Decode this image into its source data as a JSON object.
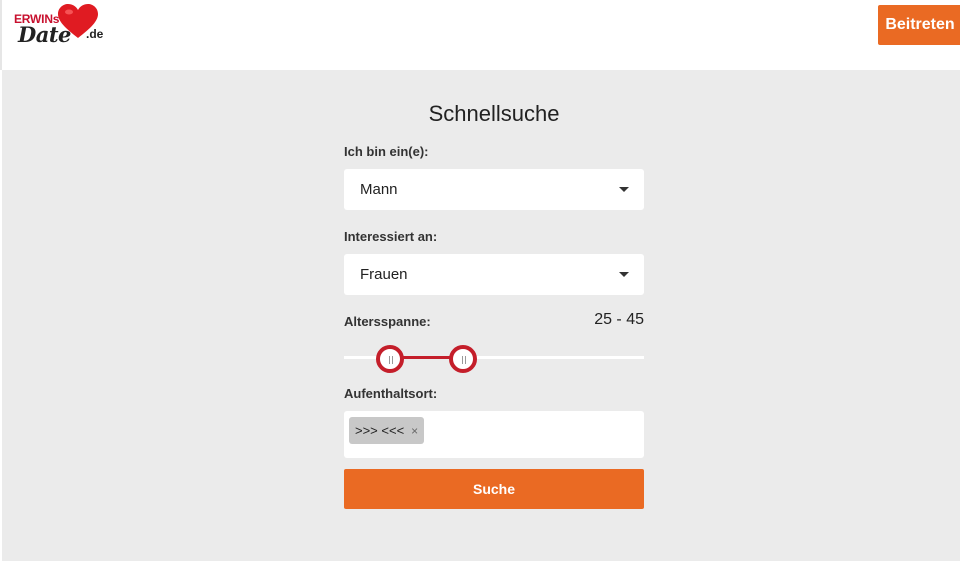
{
  "header": {
    "logo": {
      "word_top": "ERWINs",
      "word_main": "Date",
      "tld": ".de",
      "icon": "heart-icon"
    },
    "join_label": "Beitreten"
  },
  "search": {
    "title": "Schnellsuche",
    "gender": {
      "label": "Ich bin ein(e):",
      "value": "Mann"
    },
    "interest": {
      "label": "Interessiert an:",
      "value": "Frauen"
    },
    "age": {
      "label": "Altersspanne:",
      "value_text": "25 - 45",
      "min": 25,
      "max": 45
    },
    "location": {
      "label": "Aufenthaltsort:",
      "tag": ">>> <<<",
      "tag_remove": "×"
    },
    "submit_label": "Suche"
  },
  "colors": {
    "accent": "#ea6a23",
    "slider": "#c41e2a",
    "background": "#ebebeb"
  }
}
